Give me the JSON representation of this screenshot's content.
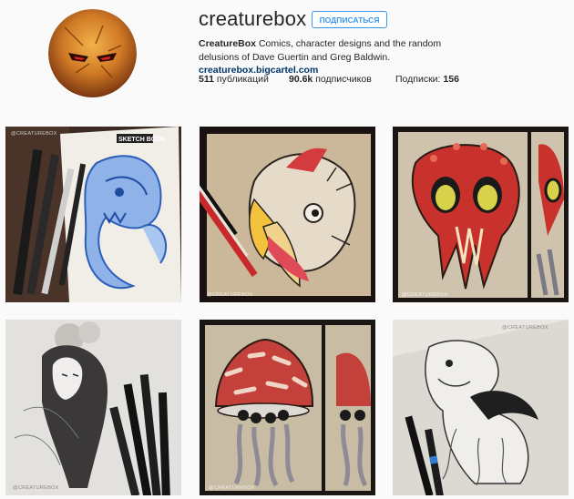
{
  "profile": {
    "username": "creaturebox",
    "follow_label": "ПОДПИСАТЬСЯ",
    "bio_name": "CreatureBox",
    "bio_text": " Comics, character designs and the random delusions of Dave Guertin and Greg Baldwin. ",
    "bio_link": "creaturebox.bigcartel.com"
  },
  "stats": {
    "posts_count": "511",
    "posts_label": " публикаций",
    "followers_count": "90.6k",
    "followers_label": " подписчиков",
    "following_label": "Подписки: ",
    "following_count": "156"
  },
  "posts": [
    {
      "watermark": "@CREATUREBOX",
      "sketchbook_label": "SKETCH BOOK"
    },
    {
      "watermark": "@CREATUREBOX"
    },
    {
      "watermark": "@CREATUREBOX"
    },
    {
      "watermark": "@CREATUREBOX"
    },
    {
      "watermark": "@CREATUREBOX"
    },
    {
      "watermark": "@CREATUREBOX"
    }
  ],
  "colors": {
    "accent": "#3897f0",
    "link": "#003569",
    "background": "#fafafa"
  }
}
